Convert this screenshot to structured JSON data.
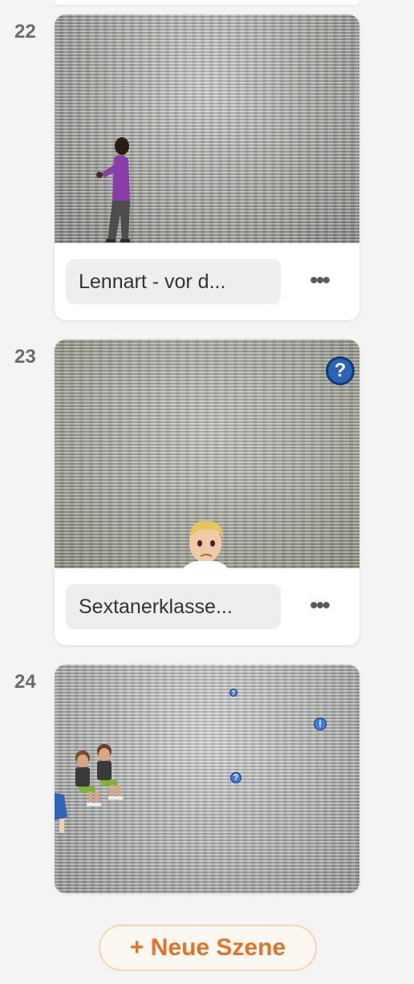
{
  "scenes": [
    {
      "number": "22",
      "title": "Lennart - vor d..."
    },
    {
      "number": "23",
      "title": "Sextanerklasse..."
    },
    {
      "number": "24",
      "title": ""
    }
  ],
  "more_label": "•••",
  "help_glyph": "?",
  "info_glyph": "!",
  "new_scene_label": "+ Neue Szene",
  "colors": {
    "accent": "#e1732a",
    "background": "#f4f4f4",
    "card": "#ffffff",
    "name_field": "#eeeeee"
  }
}
